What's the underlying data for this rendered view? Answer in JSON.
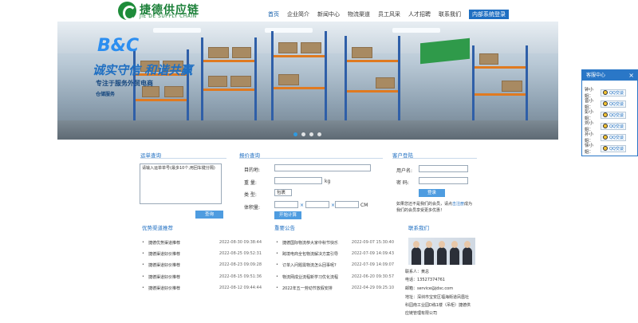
{
  "logo": {
    "cn": "捷德供应链",
    "en": "JIE DE SUPPLY CHAIN"
  },
  "nav": {
    "items": [
      "首页",
      "企业简介",
      "新闻中心",
      "物流渠道",
      "员工风采",
      "人才招聘",
      "联系我们"
    ],
    "login": "内部系统登录"
  },
  "banner": {
    "brand": "B&C",
    "slogan": "诚实守信 和谐共赢",
    "sub": "专注于服务外贸电商",
    "sub2": "仓储服务"
  },
  "waybill": {
    "title": "运单查询",
    "placeholder": "请输入运单单号(最多10个,用回车键分隔)",
    "button": "查询"
  },
  "quote": {
    "title": "报价查询",
    "dest_label": "目的地:",
    "weight_label": "重  量:",
    "weight_unit": "kg",
    "type_label": "类  型:",
    "type_value": "包裹",
    "volume_label": "体积量:",
    "volume_unit": "CM",
    "times": "×",
    "button": "开始计算"
  },
  "customer": {
    "title": "客户登陆",
    "user_label": "用户名:",
    "pass_label": "密  码:",
    "button": "登录",
    "note_prefix": "如果您还不是我们的会员，请点",
    "note_link": "击注册",
    "note_suffix": "成为我们的会员享受更多优惠！"
  },
  "channels": {
    "title": "优势渠道推荐",
    "items": [
      {
        "text": "捷德优势渠道推荐",
        "date": "2022-08-30 09:38:44"
      },
      {
        "text": "捷德渠道好价推荐",
        "date": "2022-08-25 09:52:31"
      },
      {
        "text": "捷德渠道好价推荐",
        "date": "2022-08-23 09:09:28"
      },
      {
        "text": "捷德渠道好价推荐",
        "date": "2022-08-15 09:51:36"
      },
      {
        "text": "捷德渠道好价推荐",
        "date": "2022-08-12 09:44:44"
      }
    ]
  },
  "news": {
    "title": "重要公告",
    "items": [
      {
        "text": "捷德国际物流恭大家中秋节快乐",
        "date": "2022-09-07 15:30:40"
      },
      {
        "text": "跨境电商全包物流解决方案引导",
        "date": "2022-07-09 14:09:43"
      },
      {
        "text": "订单入问题需物流怎么回事呢?",
        "date": "2022-07-09 14:09:07"
      },
      {
        "text": "物流网成业流程新学习优化流程",
        "date": "2022-06-20 09:30:57"
      },
      {
        "text": "2022年五一劳动节放假安排",
        "date": "2022-04-29 09:25:10"
      }
    ]
  },
  "contact": {
    "title": "联系我们",
    "person": "联系人：黄总",
    "phone": "电话：13527374761",
    "email": "邮箱：service@jdsc.com",
    "address1": "地址：深圳市宝安区福海街道凤凰社",
    "address2": "科园南工业园D栋1楼（吊柜）捷德供",
    "address3": "应链管理有限公司"
  },
  "service": {
    "title": "客服中心",
    "close": "×",
    "qq_label": "QQ交谈",
    "agents": [
      "钟小姐：",
      "曾小姐：",
      "彭小姐：",
      "刘小姐：",
      "孙小姐：",
      "徐小姐："
    ]
  }
}
